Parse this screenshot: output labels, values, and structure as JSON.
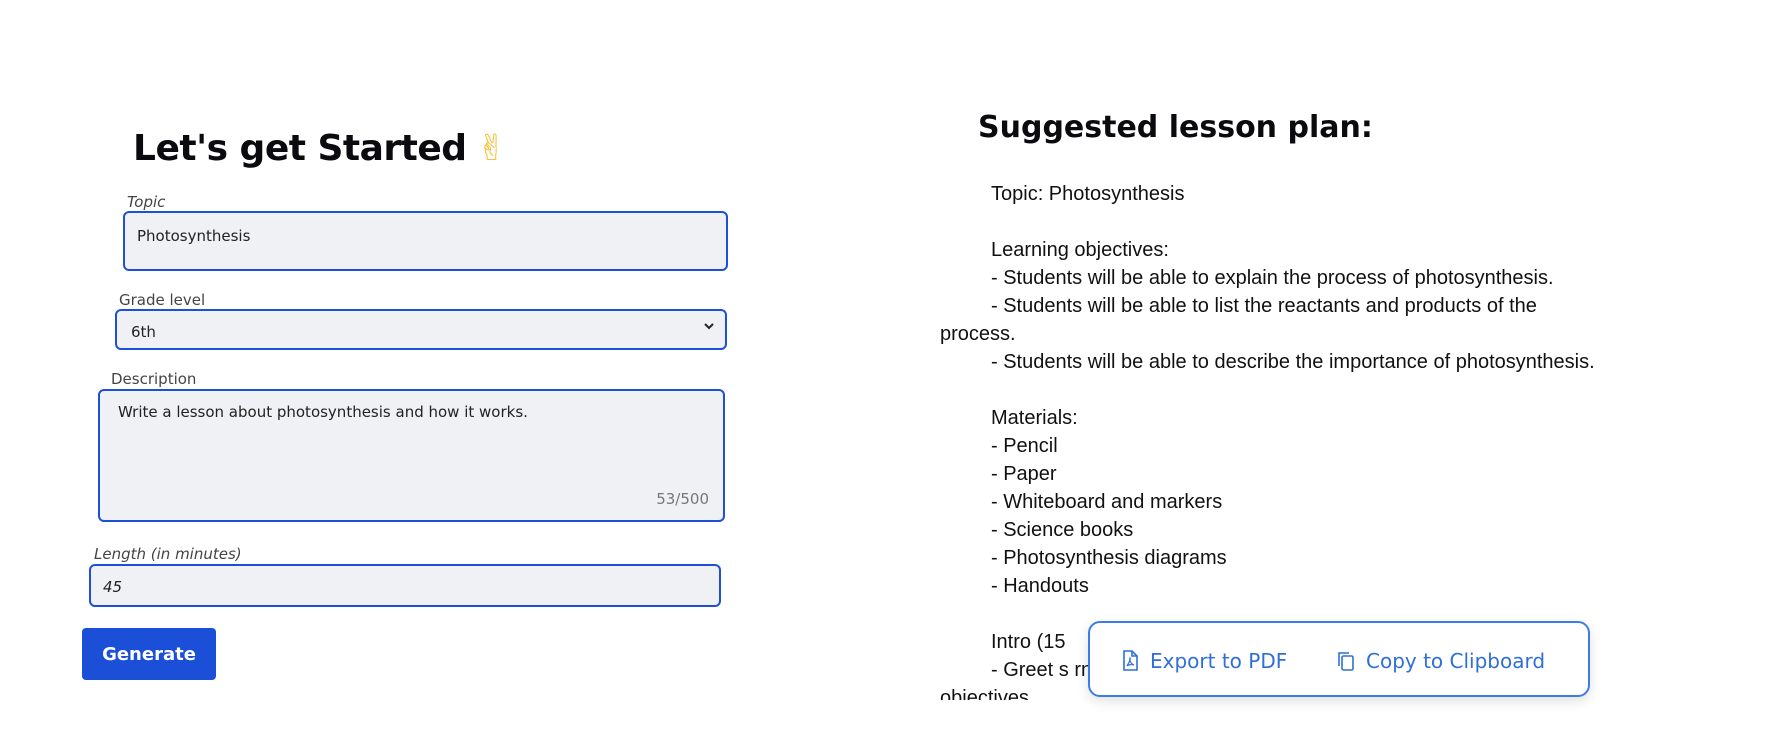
{
  "form": {
    "title": "Let's get Started",
    "title_emoji": "✌",
    "topic": {
      "label": "Topic",
      "value": "Photosynthesis"
    },
    "grade": {
      "label": "Grade level",
      "value": "6th"
    },
    "description": {
      "label": "Description",
      "value": "Write a lesson about photosynthesis and how it works.",
      "counter": "53/500"
    },
    "length": {
      "label": "Length (in minutes)",
      "value": "45"
    },
    "generate_label": "Generate"
  },
  "plan": {
    "title": "Suggested lesson plan:",
    "lines": [
      {
        "text": "Topic: Photosynthesis",
        "indent": true
      },
      {
        "text": "",
        "indent": false
      },
      {
        "text": "Learning objectives:",
        "indent": true
      },
      {
        "text": "- Students will be able to explain the process of photosynthesis.",
        "indent": true
      },
      {
        "text": "- Students will be able to list the reactants and products of the",
        "indent": true
      },
      {
        "text": "process.",
        "indent": false
      },
      {
        "text": "- Students will be able to describe the importance of photosynthesis.",
        "indent": true
      },
      {
        "text": "",
        "indent": false
      },
      {
        "text": "Materials:",
        "indent": true
      },
      {
        "text": "- Pencil",
        "indent": true
      },
      {
        "text": "- Paper",
        "indent": true
      },
      {
        "text": "- Whiteboard and markers",
        "indent": true
      },
      {
        "text": "- Science books",
        "indent": true
      },
      {
        "text": "- Photosynthesis diagrams",
        "indent": true
      },
      {
        "text": "- Handouts",
        "indent": true
      },
      {
        "text": "",
        "indent": false
      },
      {
        "text": "Intro (15",
        "indent": true
      },
      {
        "text": "- Greet s                                                                             rning",
        "indent": true
      },
      {
        "text": "objectives.",
        "indent": false
      }
    ]
  },
  "actions": {
    "export_pdf": "Export to PDF",
    "copy_clipboard": "Copy to Clipboard"
  },
  "colors": {
    "accent": "#1b4fd8",
    "link": "#2f6fd6",
    "field_bg": "#f0f1f4"
  },
  "icons": {
    "export": "pdf-file-icon",
    "copy": "copy-icon",
    "select": "chevron-down-icon"
  }
}
